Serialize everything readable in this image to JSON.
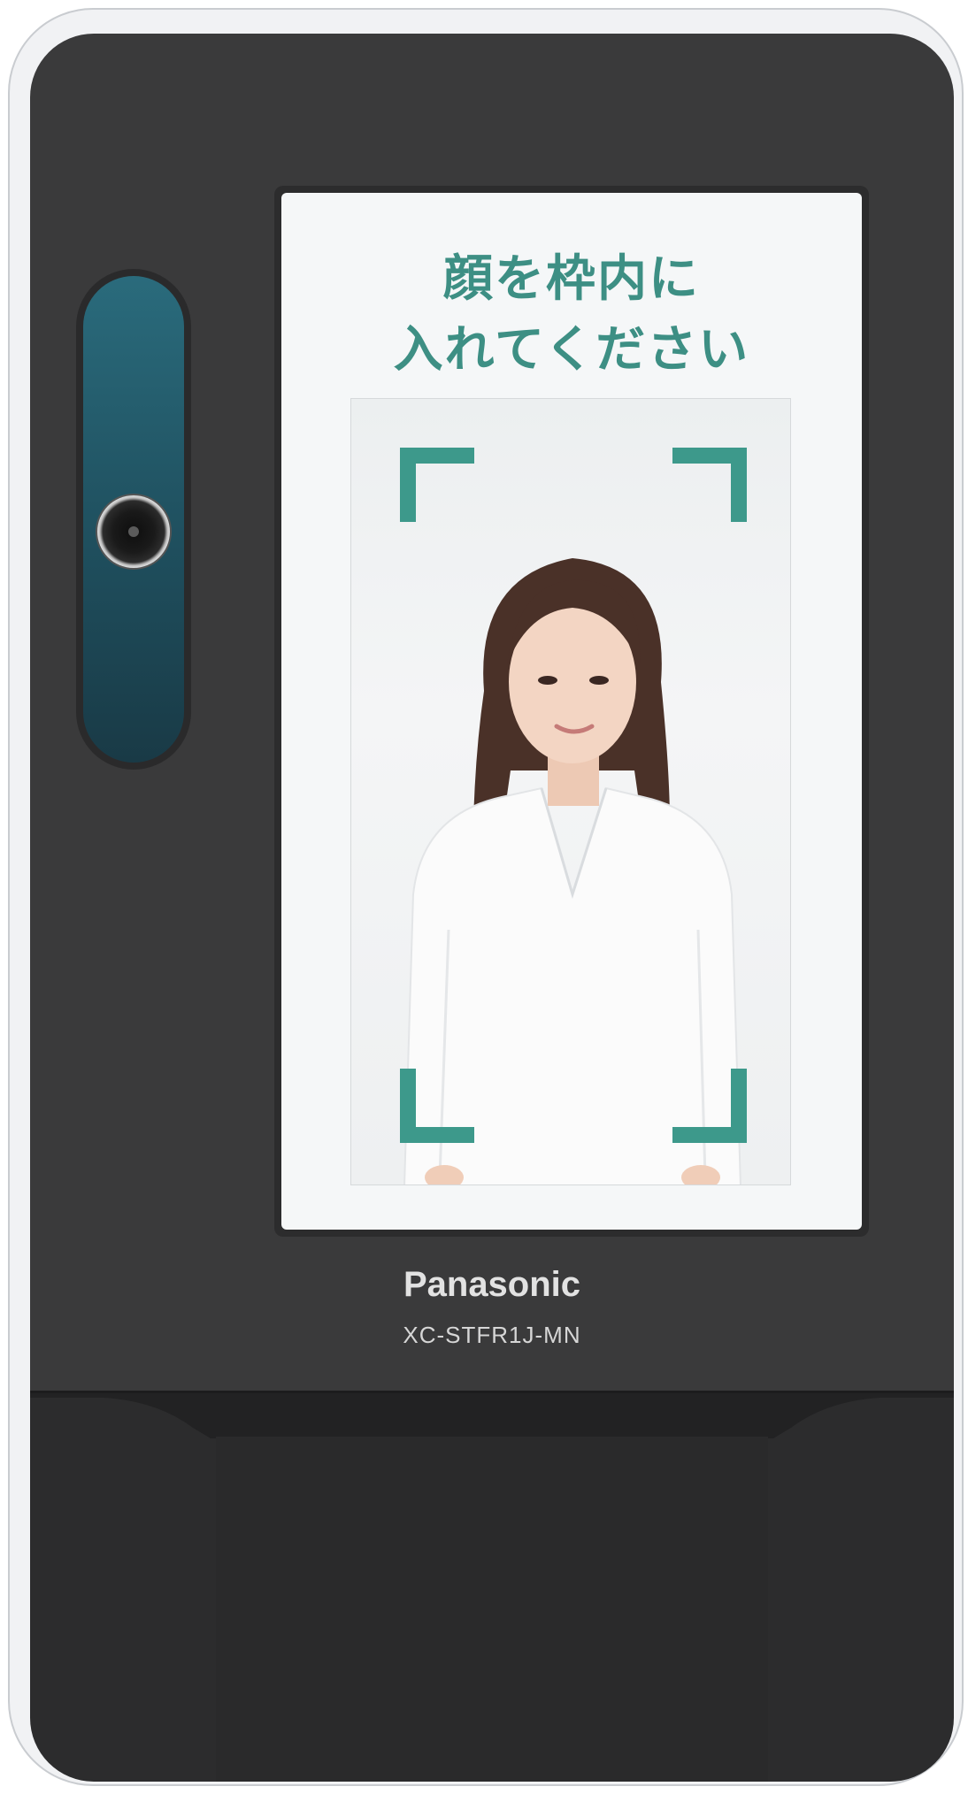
{
  "device": {
    "brand": "Panasonic",
    "model": "XC-STFR1J-MN",
    "body_color": "#3a3a3b",
    "accent_color": "#3d8f84"
  },
  "screen": {
    "prompt_line_1": "顔を枠内に",
    "prompt_line_2": "入れてください"
  },
  "icons": {
    "camera": "camera-lens-icon",
    "frame_corners": [
      "frame-corner-top-left-icon",
      "frame-corner-top-right-icon",
      "frame-corner-bottom-left-icon",
      "frame-corner-bottom-right-icon"
    ]
  }
}
